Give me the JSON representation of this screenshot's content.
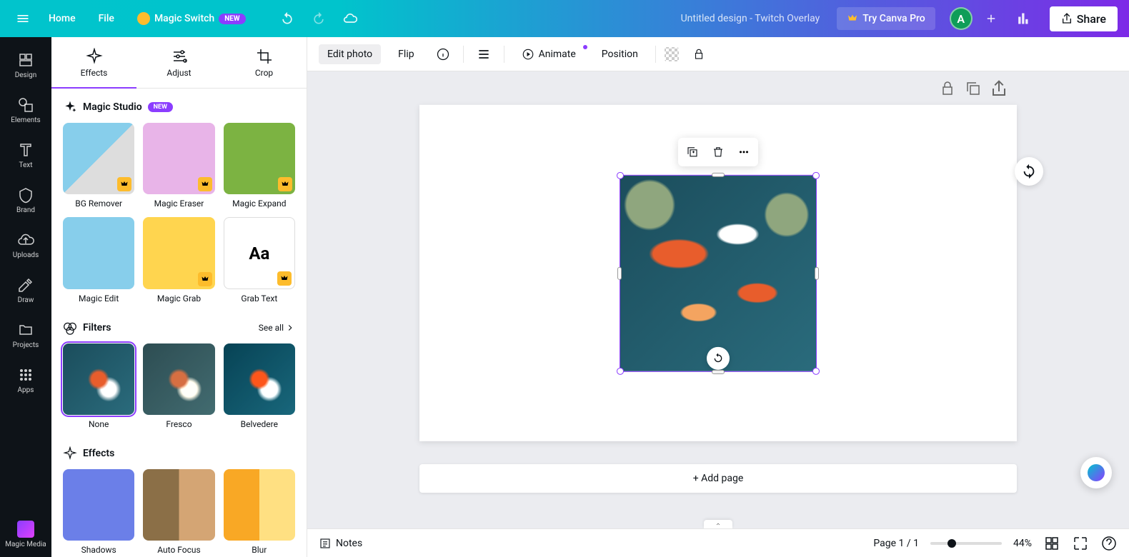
{
  "top_bar": {
    "home": "Home",
    "file": "File",
    "magic_switch": "Magic Switch",
    "magic_switch_badge": "NEW",
    "doc_title": "Untitled design - Twitch Overlay",
    "try_pro": "Try Canva Pro",
    "avatar_initial": "A",
    "share": "Share"
  },
  "left_rail": {
    "design": "Design",
    "elements": "Elements",
    "text": "Text",
    "brand": "Brand",
    "uploads": "Uploads",
    "draw": "Draw",
    "projects": "Projects",
    "apps": "Apps",
    "magic_media": "Magic Media"
  },
  "panel": {
    "tabs": {
      "effects": "Effects",
      "adjust": "Adjust",
      "crop": "Crop"
    },
    "magic_studio": {
      "title": "Magic Studio",
      "badge": "NEW",
      "items": [
        {
          "label": "BG Remover",
          "pro": true
        },
        {
          "label": "Magic Eraser",
          "pro": true
        },
        {
          "label": "Magic Expand",
          "pro": true
        },
        {
          "label": "Magic Edit",
          "pro": false
        },
        {
          "label": "Magic Grab",
          "pro": true
        },
        {
          "label": "Grab Text",
          "pro": true
        }
      ]
    },
    "filters": {
      "title": "Filters",
      "see_all": "See all",
      "items": [
        {
          "label": "None",
          "selected": true
        },
        {
          "label": "Fresco",
          "selected": false
        },
        {
          "label": "Belvedere",
          "selected": false
        }
      ]
    },
    "effects": {
      "title": "Effects",
      "items": [
        {
          "label": "Shadows"
        },
        {
          "label": "Auto Focus"
        },
        {
          "label": "Blur"
        }
      ]
    }
  },
  "canvas_toolbar": {
    "edit_photo": "Edit photo",
    "flip": "Flip",
    "animate": "Animate",
    "position": "Position"
  },
  "canvas": {
    "add_page": "+ Add page"
  },
  "bottom_bar": {
    "notes": "Notes",
    "page_indicator": "Page 1 / 1",
    "zoom": "44%"
  }
}
